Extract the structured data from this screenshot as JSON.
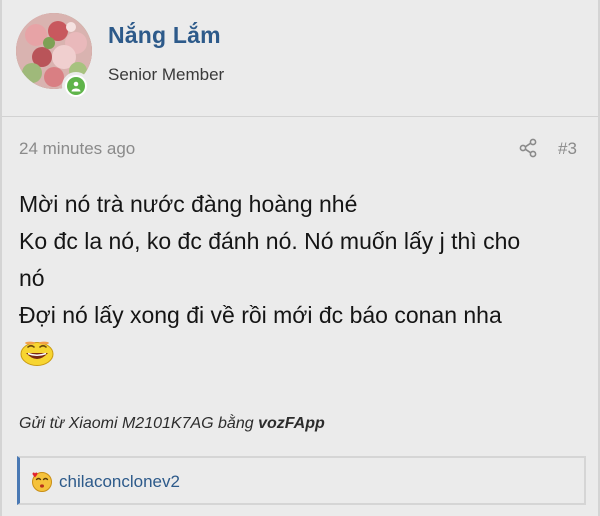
{
  "user": {
    "name": "Nắng Lắm",
    "title": "Senior Member",
    "avatar": "fruit-photo-avatar",
    "online_color": "#5fb44a"
  },
  "post": {
    "timestamp": "24 minutes ago",
    "number": "#3",
    "lines": [
      "Mời nó trà nước đàng hoàng nhé",
      "Ko đc la nó, ko đc đánh nó. Nó muốn lấy j thì cho",
      "nó",
      "Đợi nó lấy xong đi về rồi mới đc báo conan nha"
    ],
    "signature_prefix": "Gửi từ Xiaomi M2101K7AG bằng",
    "signature_app": "vozFApp"
  },
  "reactions": {
    "user": "chilaconclonev2",
    "icon": "kiss-emoji-icon"
  },
  "colors": {
    "username": "#2d5a8a",
    "reaction_bar_accent": "#4a79b4",
    "background": "#ebebeb"
  }
}
